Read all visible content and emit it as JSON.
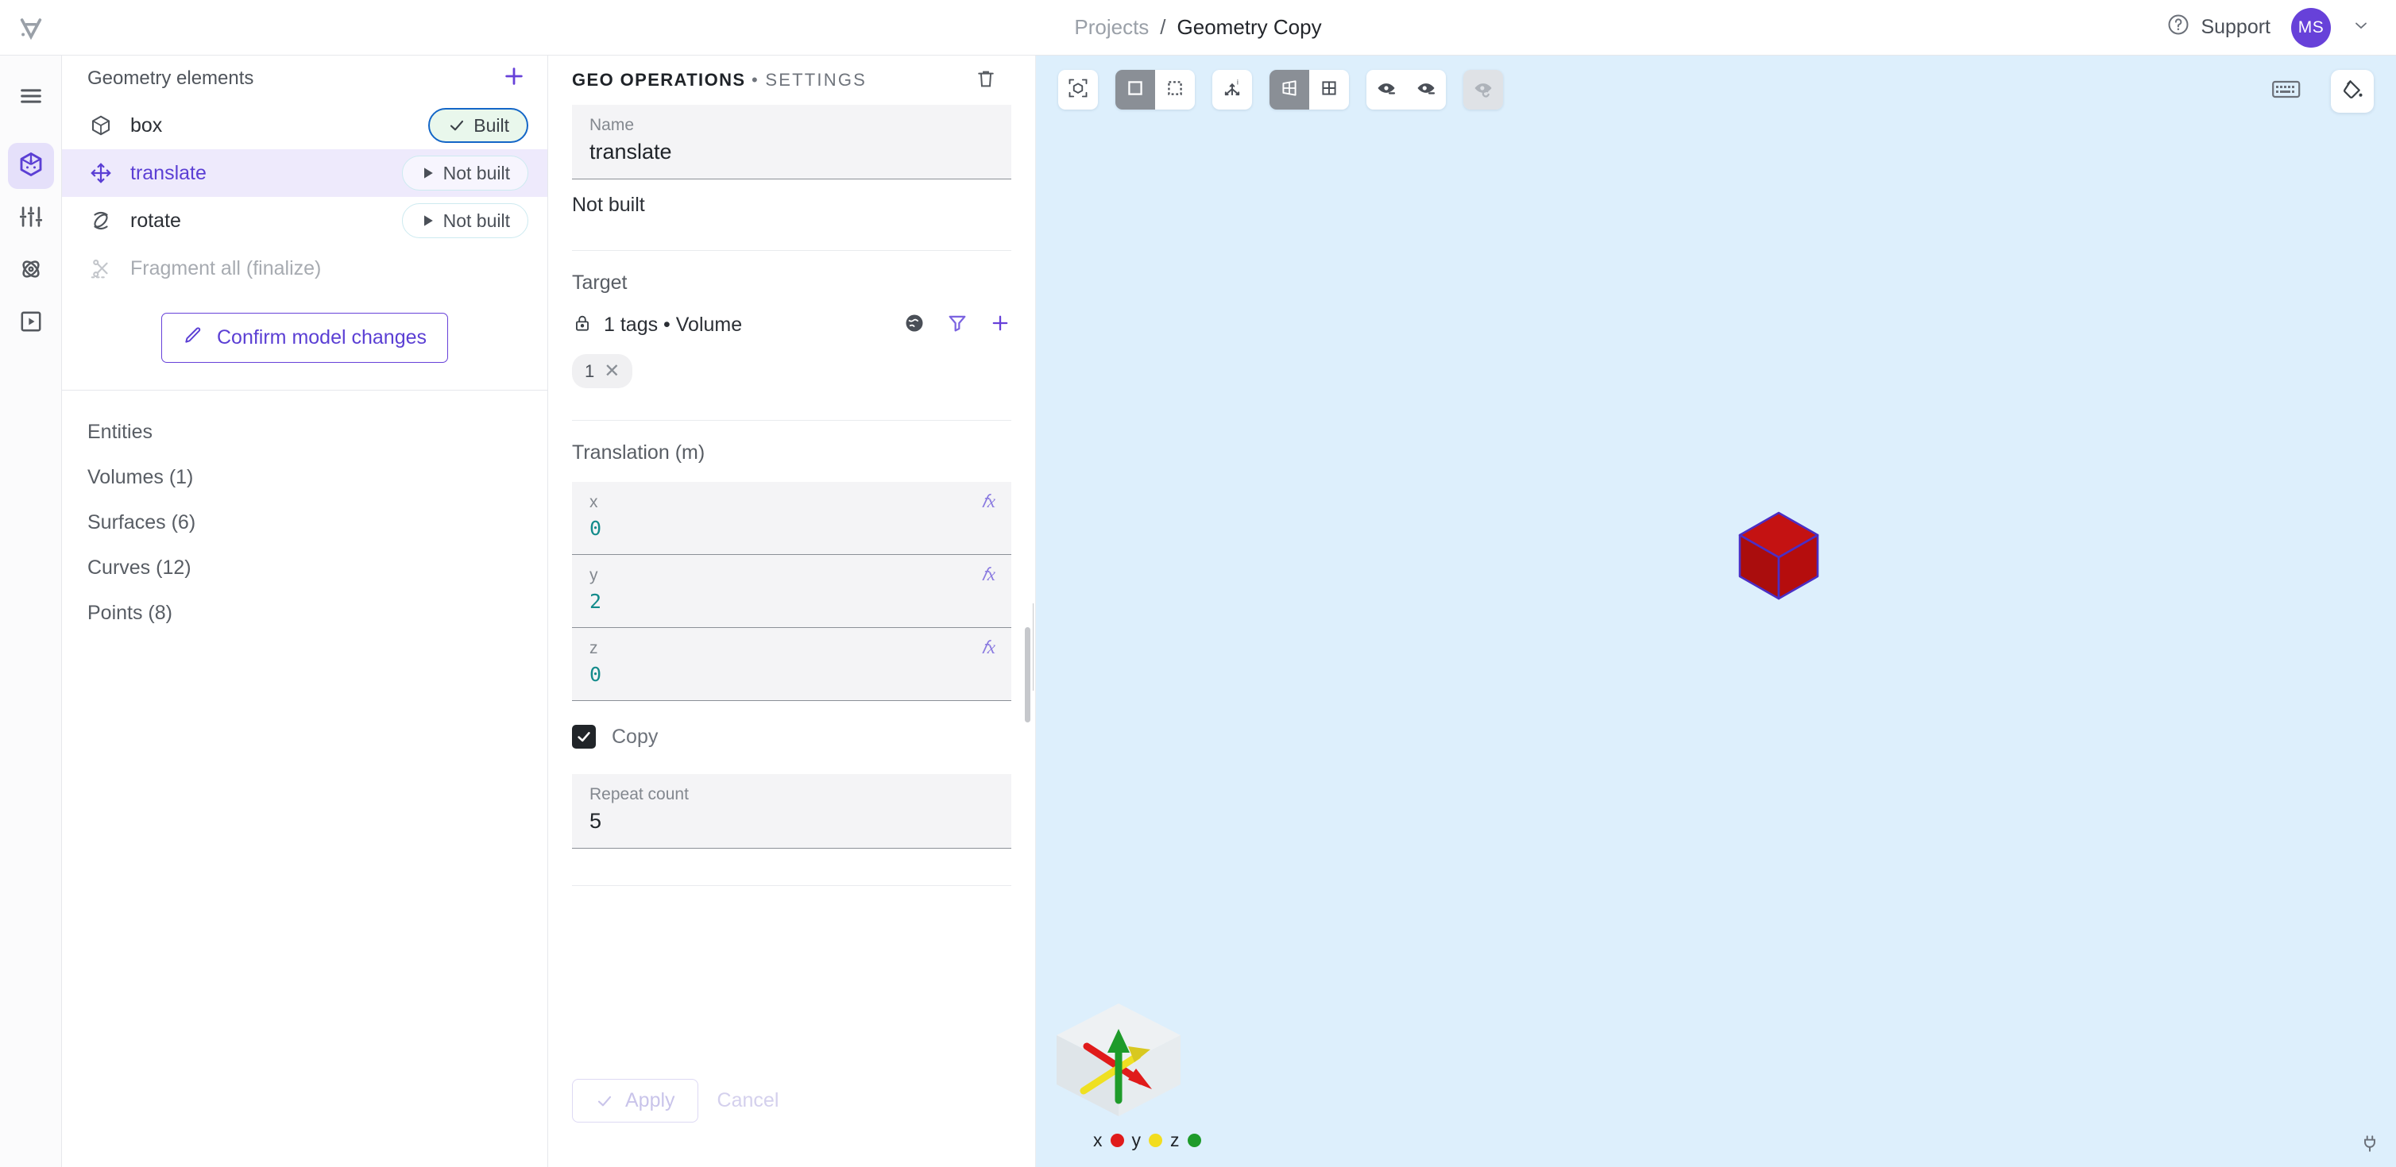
{
  "app": {
    "logo_icon": "brand-logo-icon",
    "accent_color": "#6741d9",
    "viewport_bg": "#ddeffc"
  },
  "topbar": {
    "breadcrumb": {
      "root": "Projects",
      "separator": "/",
      "current": "Geometry Copy"
    },
    "support_label": "Support",
    "support_icon": "question-circle-icon",
    "avatar_initials": "MS",
    "avatar_color": "#6741d9",
    "caret_icon": "chevron-down-icon"
  },
  "rail": {
    "items": [
      {
        "name": "menu",
        "icon": "hamburger-menu-icon",
        "active": false
      },
      {
        "name": "geometry",
        "icon": "cube-geometry-icon",
        "active": true
      },
      {
        "name": "settings",
        "icon": "sliders-icon",
        "active": false
      },
      {
        "name": "physics",
        "icon": "atom-icon",
        "active": false
      },
      {
        "name": "run",
        "icon": "play-box-icon",
        "active": false
      }
    ]
  },
  "geometry_panel": {
    "title": "Geometry elements",
    "add_icon": "plus-icon",
    "elements": [
      {
        "label": "box",
        "icon": "cube-outline-icon",
        "status": "Built",
        "status_icon": "check-icon",
        "state": "built",
        "selected": false
      },
      {
        "label": "translate",
        "icon": "move-arrows-icon",
        "status": "Not built",
        "status_icon": "play-triangle-icon",
        "state": "not-built",
        "selected": true
      },
      {
        "label": "rotate",
        "icon": "rotate-icon",
        "status": "Not built",
        "status_icon": "play-triangle-icon",
        "state": "not-built",
        "selected": false
      },
      {
        "label": "Fragment all (finalize)",
        "icon": "fragment-icon",
        "status": "",
        "state": "disabled",
        "selected": false
      }
    ],
    "confirm_button": {
      "label": "Confirm model changes",
      "icon": "pencil-icon"
    },
    "entities": [
      {
        "label": "Entities"
      },
      {
        "label": "Volumes (1)"
      },
      {
        "label": "Surfaces (6)"
      },
      {
        "label": "Curves (12)"
      },
      {
        "label": "Points (8)"
      }
    ]
  },
  "settings_panel": {
    "header_primary": "GEO OPERATIONS",
    "header_bullet": "•",
    "header_secondary": "SETTINGS",
    "delete_icon": "trash-icon",
    "name_field": {
      "label": "Name",
      "value": "translate"
    },
    "status": "Not built",
    "target": {
      "section_label": "Target",
      "lock_icon": "lock-icon",
      "summary": "1 tags • Volume",
      "globe_icon": "globe-icon",
      "filter_icon": "filter-icon",
      "add_icon": "plus-icon",
      "chips": [
        {
          "label": "1",
          "remove_icon": "close-icon"
        }
      ]
    },
    "translation": {
      "section_label": "Translation (m)",
      "fx_icon": "function-icon",
      "fields": [
        {
          "label": "x",
          "value": "0"
        },
        {
          "label": "y",
          "value": "2"
        },
        {
          "label": "z",
          "value": "0"
        }
      ]
    },
    "copy": {
      "label": "Copy",
      "checked": true,
      "check_icon": "check-icon"
    },
    "repeat": {
      "label": "Repeat count",
      "value": "5"
    },
    "apply_button": {
      "label": "Apply",
      "icon": "check-icon",
      "disabled": true
    },
    "cancel_button": {
      "label": "Cancel",
      "disabled": true
    }
  },
  "viewport": {
    "toolbar": [
      {
        "name": "fit-to-view",
        "icon": "cube-fit-icon",
        "active": false,
        "disabled": false,
        "group": "single"
      },
      {
        "name": "select-solid",
        "icon": "square-solid-icon",
        "active": true,
        "disabled": false,
        "group": "pair-a"
      },
      {
        "name": "select-box",
        "icon": "square-dashed-icon",
        "active": false,
        "disabled": false,
        "group": "pair-a"
      },
      {
        "name": "axis-info",
        "icon": "axis-info-icon",
        "active": false,
        "disabled": false,
        "group": "single"
      },
      {
        "name": "view-perspective",
        "icon": "perspective-icon",
        "active": true,
        "disabled": false,
        "group": "pair-b"
      },
      {
        "name": "view-grid",
        "icon": "grid-icon",
        "active": false,
        "disabled": false,
        "group": "pair-b"
      },
      {
        "name": "hide-entity",
        "icon": "eye-minus-icon",
        "active": false,
        "disabled": false,
        "group": "pair-c"
      },
      {
        "name": "hide-all",
        "icon": "eye-minus-alt-icon",
        "active": false,
        "disabled": false,
        "group": "pair-c"
      },
      {
        "name": "restore-hidden",
        "icon": "eye-refresh-icon",
        "active": false,
        "disabled": true,
        "group": "single"
      }
    ],
    "keyboard_icon": "keyboard-icon",
    "paint_icon": "paint-bucket-icon",
    "connection_icon": "plug-icon",
    "model": {
      "shape": "cube",
      "face_color": "#b50d0d",
      "top_color": "#c41212",
      "edge_color": "#4b2ec4"
    },
    "gizmo": {
      "axes": [
        {
          "label": "x",
          "color": "#e01b1b"
        },
        {
          "label": "y",
          "color": "#f2dd1f"
        },
        {
          "label": "z",
          "color": "#1e9b2a"
        }
      ]
    }
  }
}
